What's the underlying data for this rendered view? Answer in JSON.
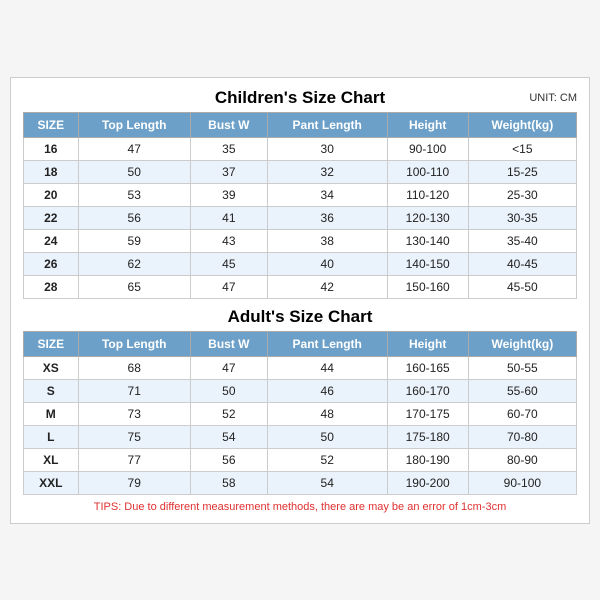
{
  "children_title": "Children's Size Chart",
  "adult_title": "Adult's Size Chart",
  "unit": "UNIT: CM",
  "tips": "TIPS: Due to different measurement methods, there are may be an error of 1cm-3cm",
  "children_headers": [
    "SIZE",
    "Top Length",
    "Bust W",
    "Pant Length",
    "Height",
    "Weight(kg)"
  ],
  "children_rows": [
    [
      "16",
      "47",
      "35",
      "30",
      "90-100",
      "<15"
    ],
    [
      "18",
      "50",
      "37",
      "32",
      "100-110",
      "15-25"
    ],
    [
      "20",
      "53",
      "39",
      "34",
      "110-120",
      "25-30"
    ],
    [
      "22",
      "56",
      "41",
      "36",
      "120-130",
      "30-35"
    ],
    [
      "24",
      "59",
      "43",
      "38",
      "130-140",
      "35-40"
    ],
    [
      "26",
      "62",
      "45",
      "40",
      "140-150",
      "40-45"
    ],
    [
      "28",
      "65",
      "47",
      "42",
      "150-160",
      "45-50"
    ]
  ],
  "adult_headers": [
    "SIZE",
    "Top Length",
    "Bust W",
    "Pant Length",
    "Height",
    "Weight(kg)"
  ],
  "adult_rows": [
    [
      "XS",
      "68",
      "47",
      "44",
      "160-165",
      "50-55"
    ],
    [
      "S",
      "71",
      "50",
      "46",
      "160-170",
      "55-60"
    ],
    [
      "M",
      "73",
      "52",
      "48",
      "170-175",
      "60-70"
    ],
    [
      "L",
      "75",
      "54",
      "50",
      "175-180",
      "70-80"
    ],
    [
      "XL",
      "77",
      "56",
      "52",
      "180-190",
      "80-90"
    ],
    [
      "XXL",
      "79",
      "58",
      "54",
      "190-200",
      "90-100"
    ]
  ]
}
